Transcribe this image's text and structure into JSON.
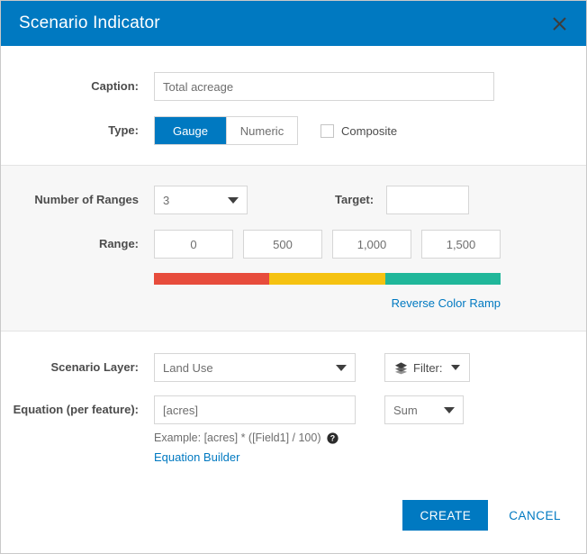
{
  "dialog": {
    "title": "Scenario Indicator",
    "close_icon": "close-icon"
  },
  "form": {
    "caption": {
      "label": "Caption:",
      "value": "Total acreage"
    },
    "type": {
      "label": "Type:",
      "options": [
        "Gauge",
        "Numeric"
      ],
      "selected": "Gauge",
      "composite_label": "Composite",
      "composite_checked": false
    },
    "ranges": {
      "number_label": "Number of Ranges",
      "number_value": "3",
      "target_label": "Target:",
      "target_value": "",
      "range_label": "Range:",
      "range_values": [
        "0",
        "500",
        "1,000",
        "1,500"
      ],
      "reverse_link": "Reverse Color Ramp",
      "ramp_colors": [
        "#e74c3c",
        "#f5c211",
        "#20b79a"
      ]
    },
    "scenario_layer": {
      "label": "Scenario Layer:",
      "value": "Land Use",
      "filter_label": "Filter:",
      "filter_icon": "layers-icon"
    },
    "equation": {
      "label": "Equation (per feature):",
      "value": "[acres]",
      "hint": "Example: [acres] * ([Field1] / 100)",
      "help_icon": "help-icon",
      "builder_link": "Equation Builder",
      "aggregation_value": "Sum"
    }
  },
  "footer": {
    "create_label": "CREATE",
    "cancel_label": "CANCEL"
  },
  "colors": {
    "accent": "#0079c1",
    "link": "#0079c1",
    "section_gray": "#f7f7f7"
  }
}
